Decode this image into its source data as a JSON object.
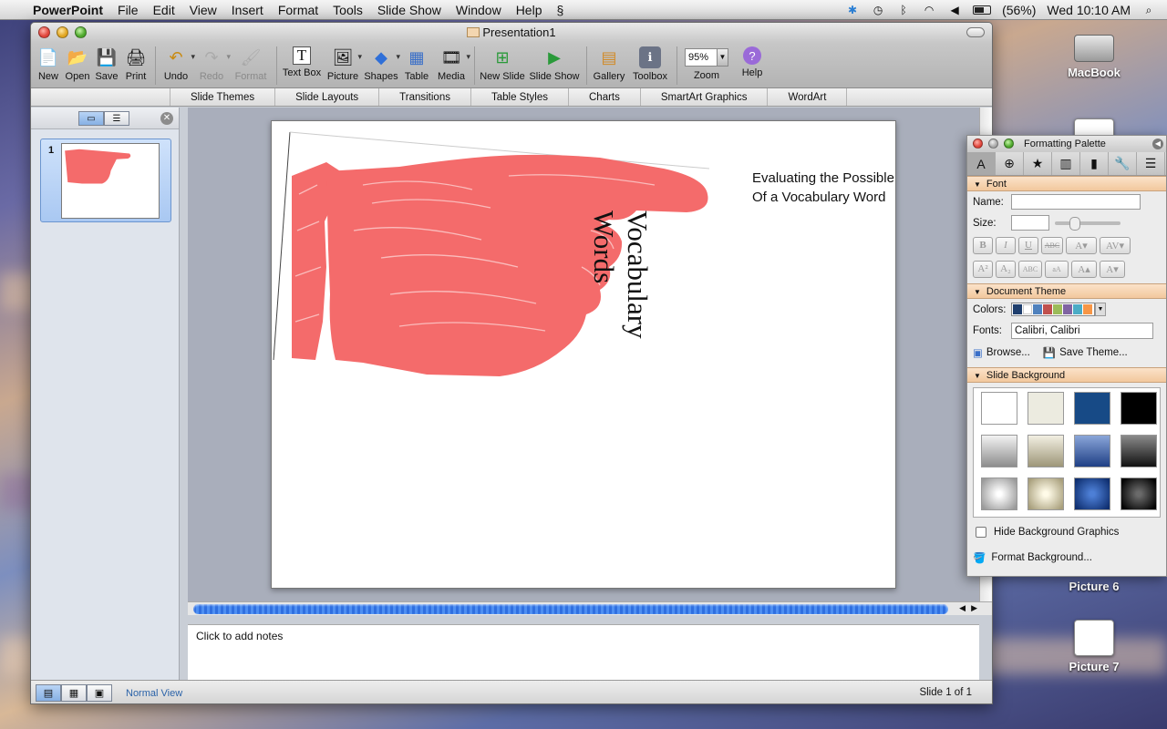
{
  "menubar": {
    "app_name": "PowerPoint",
    "menus": [
      "File",
      "Edit",
      "View",
      "Insert",
      "Format",
      "Tools",
      "Slide Show",
      "Window",
      "Help"
    ],
    "battery": "(56%)",
    "clock": "Wed 10:10 AM"
  },
  "desktop": {
    "icons": [
      "MacBook",
      "Picture 6",
      "Picture 7"
    ]
  },
  "window": {
    "title": "Presentation1",
    "toolbar": {
      "new": "New",
      "open": "Open",
      "save": "Save",
      "print": "Print",
      "undo": "Undo",
      "redo": "Redo",
      "format": "Format",
      "text_box": "Text Box",
      "picture": "Picture",
      "shapes": "Shapes",
      "table": "Table",
      "media": "Media",
      "new_slide": "New Slide",
      "slide_show": "Slide Show",
      "gallery": "Gallery",
      "toolbox": "Toolbox",
      "zoom_value": "95%",
      "zoom": "Zoom",
      "help": "Help"
    },
    "ribbon_tabs": [
      "Slide Themes",
      "Slide Layouts",
      "Transitions",
      "Table Styles",
      "Charts",
      "SmartArt Graphics",
      "WordArt"
    ],
    "slide_number": "1",
    "slide": {
      "title_line1": "Evaluating the Possible Meanings",
      "title_line2": "Of a Vocabulary Word",
      "vertical_line1": "Vocabulary",
      "vertical_line2": "Words"
    },
    "notes_placeholder": "Click to add notes",
    "status": {
      "view_name": "Normal View",
      "slide_count": "Slide 1 of 1"
    }
  },
  "palette": {
    "title": "Formatting Palette",
    "font_section": "Font",
    "name_label": "Name:",
    "size_label": "Size:",
    "theme_section": "Document Theme",
    "colors_label": "Colors:",
    "fonts_label": "Fonts:",
    "fonts_value": "Calibri, Calibri",
    "browse": "Browse...",
    "save_theme": "Save Theme...",
    "background_section": "Slide Background",
    "hide_bg": "Hide Background Graphics",
    "format_bg": "Format Background...",
    "theme_colors": [
      "#1f3f6e",
      "#ffffff",
      "#4f81bd",
      "#c0504d",
      "#9bbb59",
      "#8064a2",
      "#4bacc6",
      "#f79646"
    ],
    "accent_hand": "#f46b6b"
  }
}
